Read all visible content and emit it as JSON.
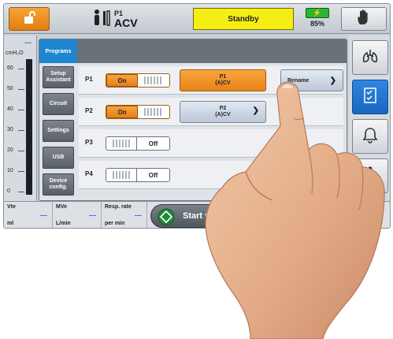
{
  "topbar": {
    "patient_id": "P1",
    "mode": "ACV",
    "status": "Standby",
    "battery_percent": "85%",
    "icons": [
      "unlock-icon",
      "patient-icon",
      "battery-icon",
      "hand-icon"
    ]
  },
  "gauge": {
    "reading": "---",
    "unit": "cmH₂O",
    "ticks": [
      "60",
      "50",
      "40",
      "30",
      "20",
      "10",
      "0"
    ]
  },
  "panel": {
    "tab": "Programs",
    "side_buttons": [
      "Setup Assistant",
      "Circuit",
      "Settings",
      "USB",
      "Device config."
    ],
    "programs": [
      {
        "label": "P1",
        "toggle_on": "On",
        "toggle_off": "",
        "state": "on",
        "mode_line1": "P1",
        "mode_line2": "(A)CV",
        "selected": true
      },
      {
        "label": "P2",
        "toggle_on": "On",
        "toggle_off": "",
        "state": "on",
        "mode_line1": "P2",
        "mode_line2": "(A)CV",
        "selected": false
      },
      {
        "label": "P3",
        "toggle_on": "",
        "toggle_off": "Off",
        "state": "off"
      },
      {
        "label": "P4",
        "toggle_on": "",
        "toggle_off": "Off",
        "state": "off"
      }
    ],
    "rename_label": "Rename"
  },
  "rail": {
    "icons": [
      "lungs-icon",
      "checklist-icon",
      "alarm-bell-icon",
      "info-icon"
    ],
    "active_index": 1
  },
  "bottombar": {
    "params": [
      {
        "name": "Vte",
        "value": "---",
        "unit": "ml"
      },
      {
        "name": "MVe",
        "value": "---",
        "unit": "L/min"
      },
      {
        "name": "Resp. rate",
        "value": "---",
        "unit": "per min"
      }
    ],
    "start_label": "Start ve"
  },
  "colors": {
    "accent_orange": "#e8831a",
    "status_yellow": "#f6ee13",
    "active_blue": "#1e86d1",
    "value_blue": "#2a5bd7"
  }
}
